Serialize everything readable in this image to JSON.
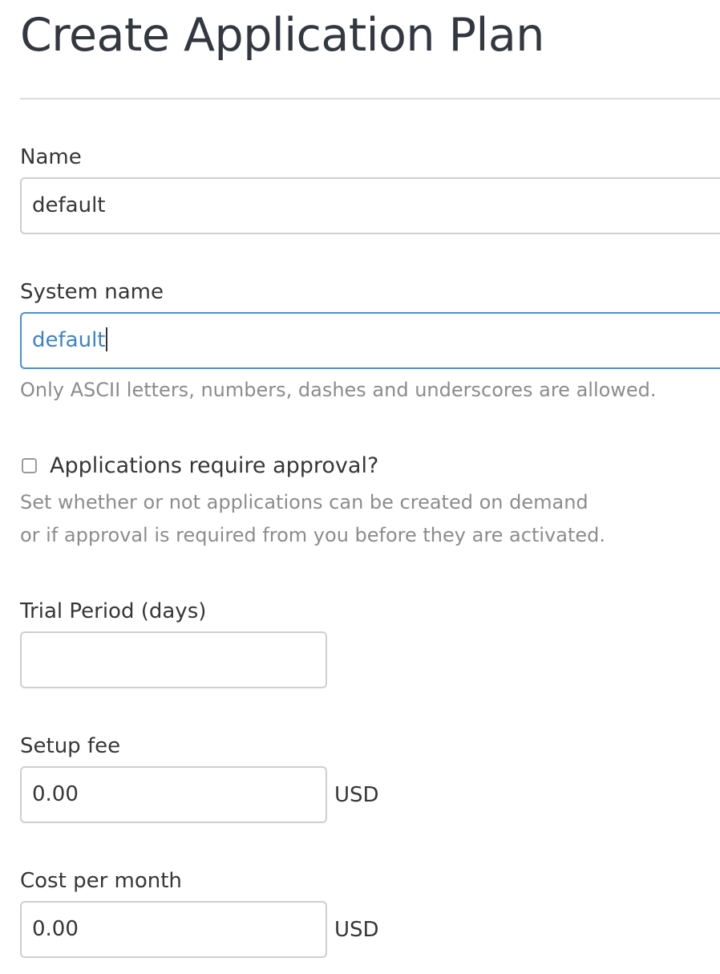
{
  "page": {
    "title": "Create Application Plan"
  },
  "form": {
    "name": {
      "label": "Name",
      "value": "default"
    },
    "system_name": {
      "label": "System name",
      "value": "default",
      "help": "Only ASCII letters, numbers, dashes and underscores are allowed."
    },
    "approval": {
      "label": "Applications require approval?",
      "checked": false,
      "help_line1": "Set whether or not applications can be created on demand",
      "help_line2": "or if approval is required from you before they are activated."
    },
    "trial_period": {
      "label": "Trial Period (days)",
      "value": ""
    },
    "setup_fee": {
      "label": "Setup fee",
      "value": "0.00",
      "unit": "USD"
    },
    "cost_per_month": {
      "label": "Cost per month",
      "value": "0.00",
      "unit": "USD"
    }
  }
}
